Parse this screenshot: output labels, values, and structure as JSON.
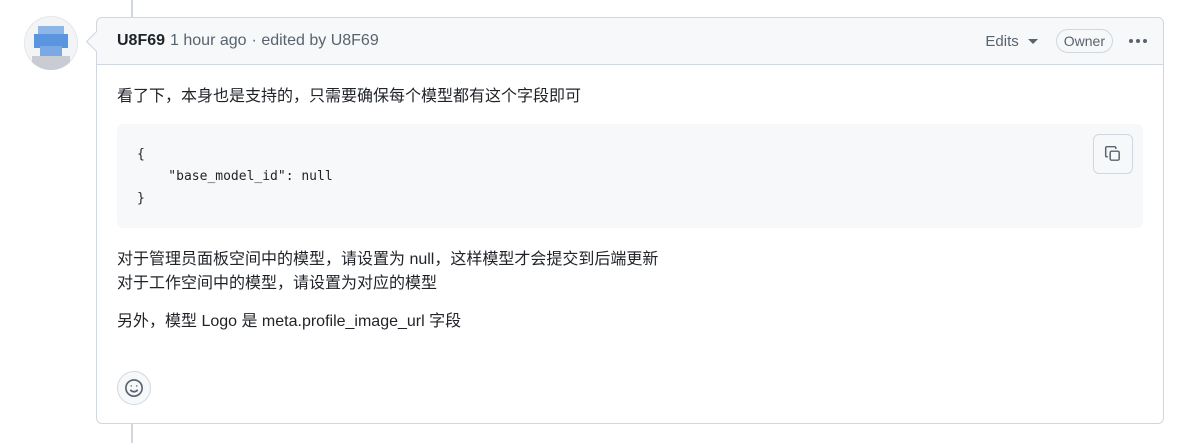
{
  "comment": {
    "author": "U8F69",
    "timestamp": "1 hour ago",
    "edited_text": "· edited by U8F69",
    "edits_label": "Edits",
    "owner_badge": "Owner",
    "more_icon": "kebab-horizontal-icon",
    "paragraphs": {
      "intro": "看了下，本身也是支持的，只需要确保每个模型都有这个字段即可",
      "line2a": "对于管理员面板空间中的模型，请设置为 null，这样模型才会提交到后端更新",
      "line2b": "对于工作空间中的模型，请设置为对应的模型",
      "line3": "另外，模型 Logo 是 meta.profile_image_url 字段"
    },
    "code": {
      "line1": "{",
      "line2": "    \"base_model_id\": null",
      "line3": "}",
      "copy_icon": "copy-icon"
    },
    "reaction_icon": "smiley-icon"
  },
  "colors": {
    "border": "#d0d7de",
    "header_bg": "#f6f8fa",
    "muted_text": "#59636e",
    "text": "#1f2328"
  }
}
